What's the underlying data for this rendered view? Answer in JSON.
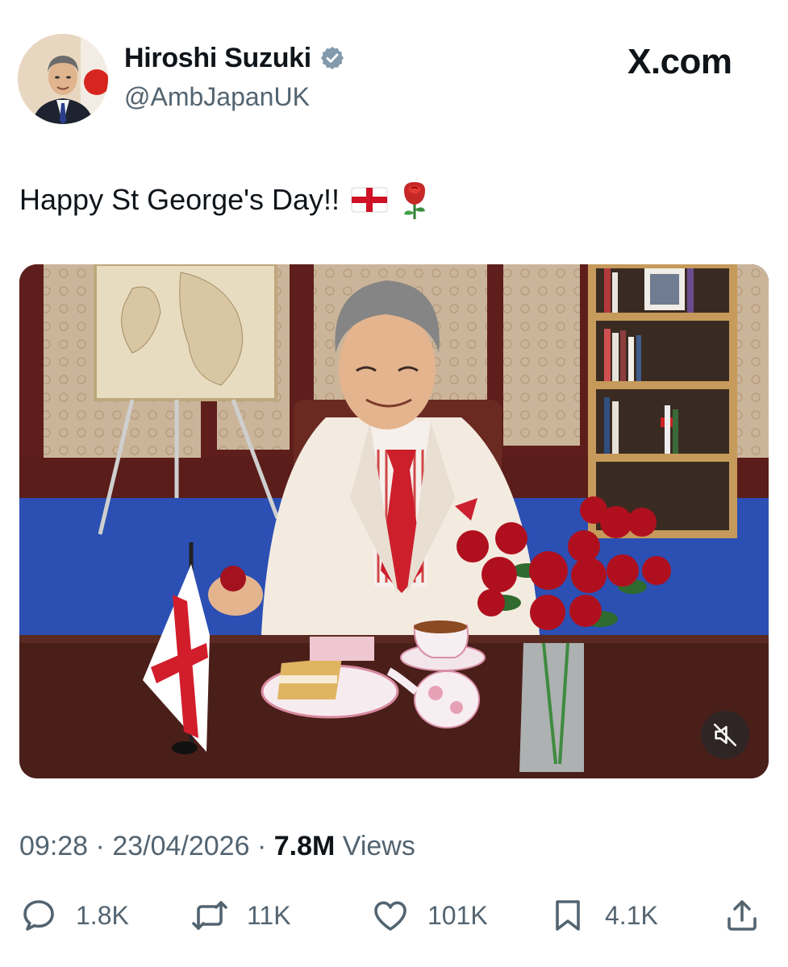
{
  "author": {
    "name": "Hiroshi Suzuki",
    "handle": "@AmbJapanUK",
    "verified": true,
    "verified_color": "#829aab"
  },
  "brand": "X.com",
  "tweet": {
    "text": "Happy St George's Day!!",
    "emojis": [
      "england-flag",
      "rose"
    ]
  },
  "media": {
    "type": "video",
    "mute_icon": "speaker-muted-icon"
  },
  "meta": {
    "time": "09:28",
    "separator": "·",
    "date": "23/04/2026",
    "views_count": "7.8M",
    "views_label": "Views"
  },
  "actions": {
    "reply": {
      "icon": "reply-icon",
      "count": "1.8K"
    },
    "repost": {
      "icon": "repost-icon",
      "count": "11K"
    },
    "like": {
      "icon": "heart-icon",
      "count": "101K"
    },
    "bookmark": {
      "icon": "bookmark-icon",
      "count": "4.1K"
    },
    "share": {
      "icon": "share-icon"
    }
  },
  "colors": {
    "text_primary": "#0f1419",
    "text_secondary": "#536471",
    "england_red": "#ce1124"
  }
}
